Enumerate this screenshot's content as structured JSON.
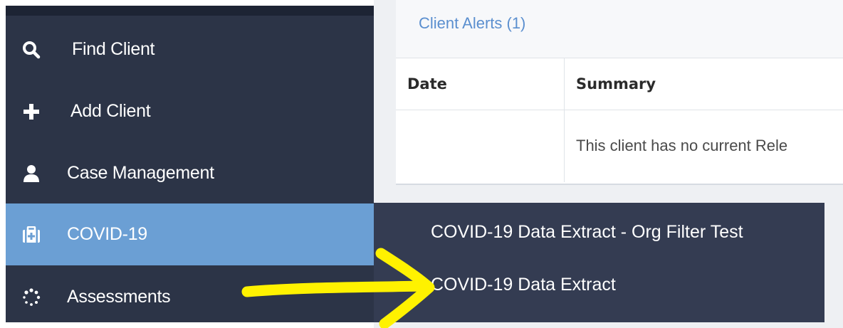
{
  "sidebar": {
    "items": [
      {
        "label": "Find Client",
        "icon": "search-icon"
      },
      {
        "label": "Add Client",
        "icon": "plus-icon"
      },
      {
        "label": "Case Management",
        "icon": "user-icon"
      },
      {
        "label": "COVID-19",
        "icon": "medkit-icon",
        "active": true
      },
      {
        "label": "Assessments",
        "icon": "spinner-icon"
      }
    ]
  },
  "alerts": {
    "title": "Client Alerts (1)",
    "columns": [
      "Date",
      "Summary"
    ],
    "empty_message": "This client has no current Rele"
  },
  "flyout": {
    "items": [
      "COVID-19 Data Extract - Org Filter Test",
      "COVID-19 Data Extract"
    ]
  },
  "colors": {
    "sidebar_bg": "#2c3447",
    "active_bg": "#6b9fd4",
    "flyout_bg": "#343c52",
    "link": "#5b8fcf",
    "annotation": "#fff200"
  }
}
